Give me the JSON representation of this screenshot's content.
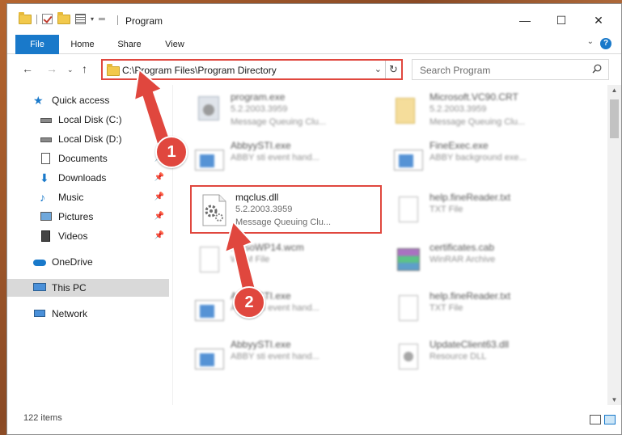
{
  "title": "Program",
  "ribbon": {
    "file": "File",
    "home": "Home",
    "share": "Share",
    "view": "View"
  },
  "address": {
    "path": "C:\\Program Files\\Program Directory"
  },
  "search": {
    "placeholder": "Search Program"
  },
  "sidebar": {
    "quick_access": "Quick access",
    "items": [
      "Local Disk (C:)",
      "Local Disk (D:)",
      "Documents",
      "Downloads",
      "Music",
      "Pictures",
      "Videos"
    ],
    "onedrive": "OneDrive",
    "this_pc": "This PC",
    "network": "Network"
  },
  "files": [
    {
      "name": "program.exe",
      "version": "5.2.2003.3959",
      "desc": "Message Queuing Clu..."
    },
    {
      "name": "Microsoft.VC90.CRT",
      "version": "5.2.2003.3959",
      "desc": "Message Queuing Clu..."
    },
    {
      "name": "AbbyySTI.exe",
      "version": "",
      "desc": "ABBY sti event hand..."
    },
    {
      "name": "FineExec.exe",
      "version": "",
      "desc": "ABBY background exe..."
    },
    {
      "name": "mqclus.dll",
      "version": "5.2.2003.3959",
      "desc": "Message Queuing Clu..."
    },
    {
      "name": "help.fineReader.txt",
      "version": "",
      "desc": "TXT File"
    },
    {
      "name": "FBSoWP14.wcm",
      "version": "",
      "desc": "WCM File"
    },
    {
      "name": "certificates.cab",
      "version": "",
      "desc": "WinRAR Archive"
    },
    {
      "name": "AbbyySTI.exe",
      "version": "",
      "desc": "ABBY sti event hand..."
    },
    {
      "name": "help.fineReader.txt",
      "version": "",
      "desc": "TXT File"
    },
    {
      "name": "AbbyySTI.exe",
      "version": "",
      "desc": "ABBY sti event hand..."
    },
    {
      "name": "UpdateClient63.dll",
      "version": "",
      "desc": "Resource DLL"
    }
  ],
  "status": {
    "count": "122 items"
  },
  "callouts": {
    "one": "1",
    "two": "2"
  },
  "colors": {
    "accent": "#1979ca",
    "highlight": "#e0473e"
  }
}
